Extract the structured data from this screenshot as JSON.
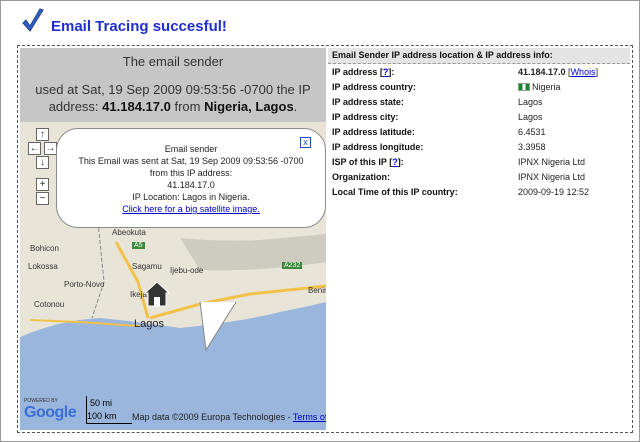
{
  "header": {
    "title": "Email Tracing succesful!"
  },
  "sender": {
    "heading": "The email sender",
    "line_prefix": "used at Sat, 19 Sep 2009 09:53:56 -0700 the IP address: ",
    "ip": "41.184.17.0",
    "from_word": " from ",
    "location": "Nigeria, Lagos",
    "period": "."
  },
  "bubble": {
    "title": "Email sender",
    "line1": "This Email was sent at Sat, 19 Sep 2009 09:53:56 -0700",
    "line2": "from this IP address:",
    "ip": "41.184.17.0",
    "location": "IP Location: Lagos in Nigeria.",
    "link": "Click here for a big satellite image.",
    "close": "x"
  },
  "map": {
    "controls": {
      "up": "↑",
      "left": "←",
      "right": "→",
      "down": "↓",
      "zoom_in": "+",
      "zoom_out": "−"
    },
    "places": [
      {
        "key": "abeokuta",
        "label": "Abeokuta"
      },
      {
        "key": "bohicon",
        "label": "Bohicon"
      },
      {
        "key": "sagamu",
        "label": "Sagamu"
      },
      {
        "key": "ikeja",
        "label": "Ikeja"
      },
      {
        "key": "ijebu",
        "label": "Ijebu-ode"
      },
      {
        "key": "porto",
        "label": "Porto-Novo"
      },
      {
        "key": "cotonou",
        "label": "Cotonou"
      },
      {
        "key": "lagos",
        "label": "Lagos"
      },
      {
        "key": "lokossa",
        "label": "Lokossa"
      },
      {
        "key": "benin",
        "label": "Benin"
      }
    ],
    "roads": {
      "a5": "A5",
      "a232": "A232"
    },
    "powered": "POWERED BY",
    "google": "Google",
    "scale_mi": "50 mi",
    "scale_km": "100 km",
    "attribution": "Map data ©2009 Europa Technologies - ",
    "terms": "Terms of Use"
  },
  "info": {
    "heading": "Email Sender IP address location & IP address info:",
    "rows": [
      {
        "label": "IP address",
        "help": "?",
        "value": "41.184.17.0",
        "link": "Whois"
      },
      {
        "label": "IP address country:",
        "value": "Nigeria"
      },
      {
        "label": "IP address state:",
        "value": "Lagos"
      },
      {
        "label": "IP address city:",
        "value": "Lagos"
      },
      {
        "label": "IP address latitude:",
        "value": "6.4531"
      },
      {
        "label": "IP address longitude:",
        "value": "3.3958"
      },
      {
        "label": "ISP of this IP",
        "help": "?",
        "value": "IPNX Nigeria Ltd"
      },
      {
        "label": "Organization:",
        "value": "IPNX Nigeria Ltd"
      },
      {
        "label": "Local Time of this IP country:",
        "value": "2009-09-19 12:52"
      }
    ]
  },
  "colors": {
    "title": "#1f2fcf",
    "sea": "#9bb6dc",
    "land": "#e8e4d8",
    "road": "#f2c14a",
    "link": "#0000cc"
  }
}
